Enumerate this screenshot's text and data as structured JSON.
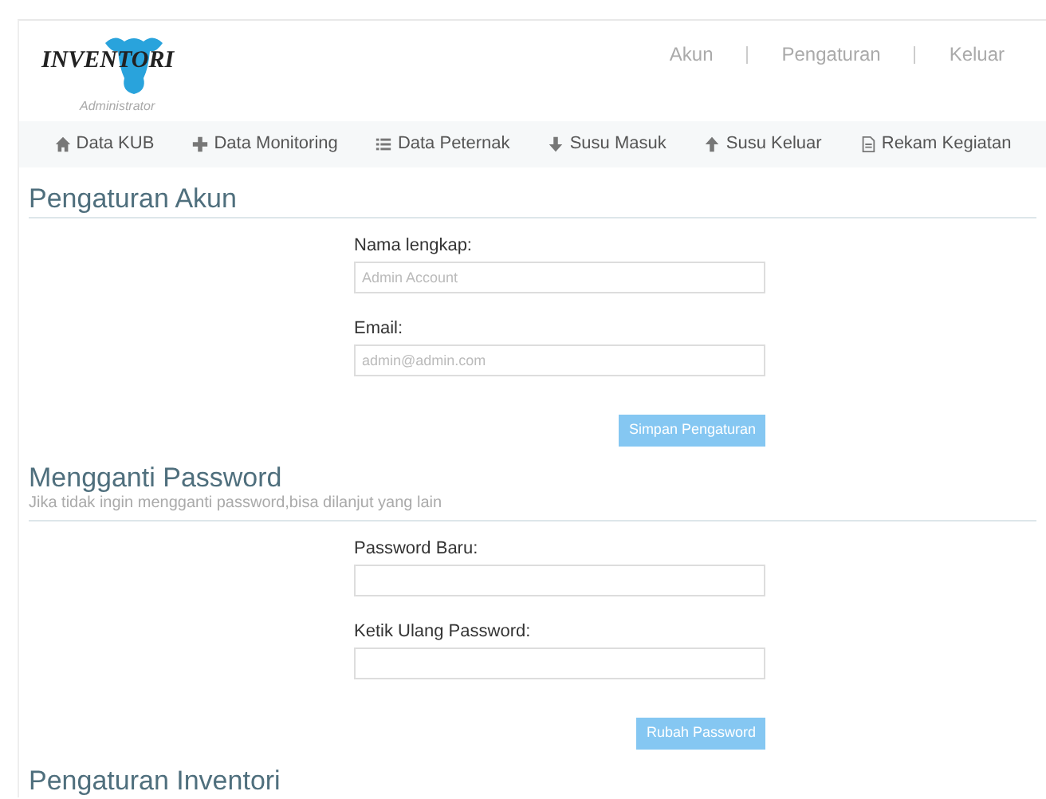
{
  "logo": {
    "title": "INVENTORI",
    "subtitle": "Administrator"
  },
  "top_links": [
    {
      "label": "Akun"
    },
    {
      "label": "Pengaturan"
    },
    {
      "label": "Keluar"
    }
  ],
  "nav": [
    {
      "label": "Data KUB",
      "kind": "home"
    },
    {
      "label": "Data Monitoring",
      "kind": "plus"
    },
    {
      "label": "Data Peternak",
      "kind": "list"
    },
    {
      "label": "Susu Masuk",
      "kind": "down"
    },
    {
      "label": "Susu Keluar",
      "kind": "up"
    },
    {
      "label": "Rekam Kegiatan",
      "kind": "file"
    }
  ],
  "sections": [
    {
      "title": "Pengaturan Akun",
      "fields": [
        {
          "label": "Nama lengkap:",
          "placeholder": "Admin Account"
        },
        {
          "label": "Email:",
          "placeholder": "admin@admin.com"
        }
      ],
      "button": "Simpan Pengaturan"
    },
    {
      "title": "Mengganti Password",
      "subtitle": "Jika tidak ingin mengganti password,bisa dilanjut yang lain",
      "fields": [
        {
          "label": "Password Baru:"
        },
        {
          "label": "Ketik Ulang Password:"
        }
      ],
      "button": "Rubah Password"
    },
    {
      "title": "Pengaturan Inventori"
    }
  ]
}
